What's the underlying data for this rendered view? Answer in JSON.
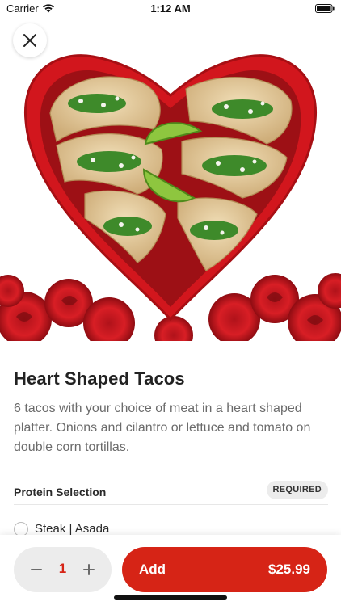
{
  "status_bar": {
    "carrier": "Carrier",
    "time": "1:12 AM"
  },
  "hero": {
    "description_icon": "heart-shaped-taco-platter-photo"
  },
  "item": {
    "title": "Heart Shaped Tacos",
    "description": "6 tacos with your choice of meat in a heart shaped platter.  Onions and cilantro or lettuce and tomato on double corn tortillas."
  },
  "protein_section": {
    "title": "Protein Selection",
    "badge": "REQUIRED",
    "options": [
      {
        "label": "Steak | Asada",
        "selected": false
      }
    ]
  },
  "order_bar": {
    "quantity": "1",
    "add_label": "Add",
    "price": "$25.99"
  },
  "colors": {
    "accent": "#d62416",
    "badge_bg": "#ececec",
    "text_muted": "#6b6b6b"
  }
}
